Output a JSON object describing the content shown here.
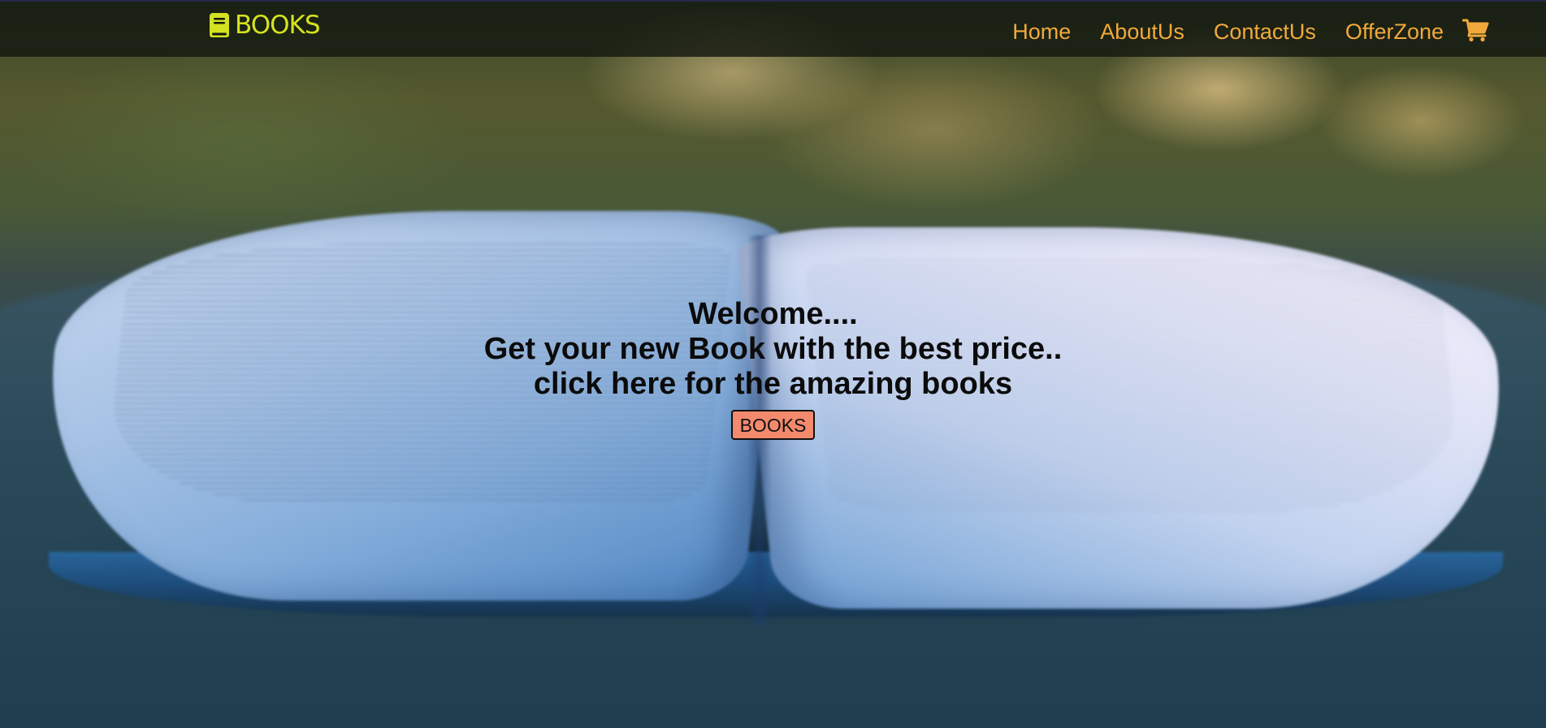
{
  "navbar": {
    "logo_text": "BOOKS",
    "links": [
      {
        "label": "Home"
      },
      {
        "label": "AboutUs"
      },
      {
        "label": "ContactUs"
      },
      {
        "label": "OfferZone"
      }
    ],
    "cart_icon": "shopping-cart-icon"
  },
  "hero": {
    "line1": "Welcome....",
    "line2": "Get your new Book with the best price..",
    "line3": "click here for the amazing books",
    "button_label": "BOOKS"
  },
  "colors": {
    "logo": "#d4e21f",
    "nav_link": "#f2a93b",
    "button_bg": "#f3896d",
    "navbar_bg": "#141810"
  }
}
